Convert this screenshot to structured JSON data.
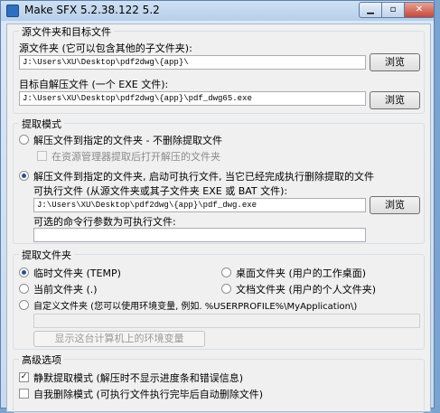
{
  "window": {
    "title": "Make SFX 5.2.38.122 5.2",
    "min_icon": "minimize-icon",
    "max_icon": "maximize-icon",
    "close_icon": "close-icon",
    "close_glyph": "✕",
    "max_glyph": "▫",
    "min_glyph": "▁"
  },
  "source_target": {
    "group_title": "源文件夹和目标文件",
    "source_label": "源文件夹 (它可以包含其他的子文件夹):",
    "source_value": "J:\\Users\\XU\\Desktop\\pdf2dwg\\{app}\\",
    "target_label": "目标自解压文件 (一个 EXE 文件):",
    "target_value": "J:\\Users\\XU\\Desktop\\pdf2dwg\\{app}\\pdf_dwg65.exe",
    "browse_label": "浏览"
  },
  "extract_mode": {
    "group_title": "提取模式",
    "option1": "解压文件到指定的文件夹 - 不删除提取文件",
    "option1_sub": "在资源管理器提取后打开解压的文件夹",
    "option2": "解压文件到指定的文件夹, 启动可执行文件, 当它已经完成执行删除提取的文件",
    "exe_label": "可执行文件 (从源文件夹或其子文件夹 EXE 或 BAT 文件):",
    "exe_value": "J:\\Users\\XU\\Desktop\\pdf2dwg\\{app}\\pdf_dwg.exe",
    "browse_label": "浏览",
    "params_label": "可选的命令行参数为可执行文件:",
    "params_value": ""
  },
  "extract_folder": {
    "group_title": "提取文件夹",
    "temp": "临时文件夹 (TEMP)",
    "desktop": "桌面文件夹 (用户的工作桌面)",
    "current": "当前文件夹 (.)",
    "documents": "文档文件夹 (用户的个人文件夹)",
    "custom": "自定义文件夹 (您可以使用环境变量, 例如. %USERPROFILE%\\MyApplication\\)",
    "custom_value": "",
    "show_env_label": "显示这台计算机上的环境变量"
  },
  "advanced": {
    "group_title": "高级选项",
    "silent": "静默提取模式 (解压时不显示进度条和错误信息)",
    "second_partial": "自我删除模式 (可执行文件执行完毕后自动删除文件)"
  }
}
